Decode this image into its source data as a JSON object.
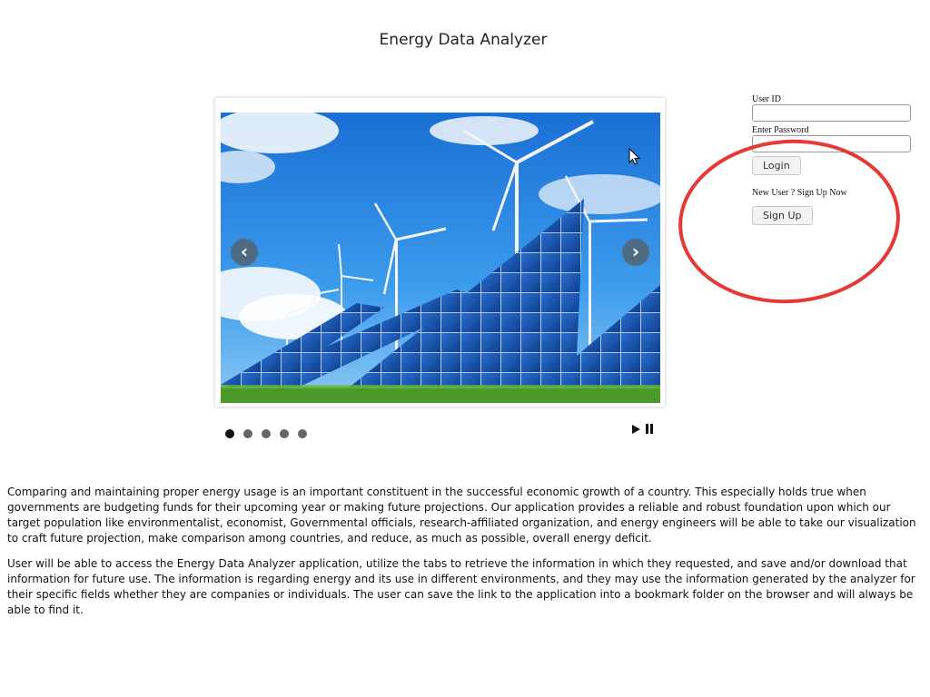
{
  "header": {
    "title": "Energy Data Analyzer"
  },
  "carousel": {
    "slide_count": 5,
    "active_slide": 1,
    "prev_glyph": "‹",
    "next_glyph": "›",
    "icons": [
      "chevron-left-icon",
      "chevron-right-icon",
      "play-icon",
      "pause-icon"
    ]
  },
  "login": {
    "user_id_label": "User ID",
    "user_id_value": "",
    "password_label": "Enter Password",
    "password_value": "",
    "login_button": "Login",
    "signup_prompt": "New User ? Sign Up Now",
    "signup_button": "Sign Up"
  },
  "description": {
    "paragraph_1": "Comparing and maintaining proper energy usage is an important constituent in the successful economic growth of a country. This especially holds true when governments are budgeting funds for their upcoming year or making future projections. Our application provides a reliable and robust foundation upon which our target population like environmentalist, economist, Governmental officials, research-affiliated organization, and energy engineers will be able to take our visualization to craft future projection, make comparison among countries, and reduce, as much as possible, overall energy deficit.",
    "paragraph_2": "User will be able to access the Energy Data Analyzer application, utilize the tabs to retrieve the information in which they requested, and save and/or download that information for future use. The information is regarding energy and its use in different environments, and they may use the information generated by the analyzer for their specific fields whether they are companies or individuals. The user can save the link to the application into a bookmark folder on the browser and will always be able to find it."
  },
  "colors": {
    "annotation_circle": "#e53935",
    "sky": "#2a8be0",
    "panel": "#1f5fb8",
    "grass": "#4a9a2a"
  }
}
